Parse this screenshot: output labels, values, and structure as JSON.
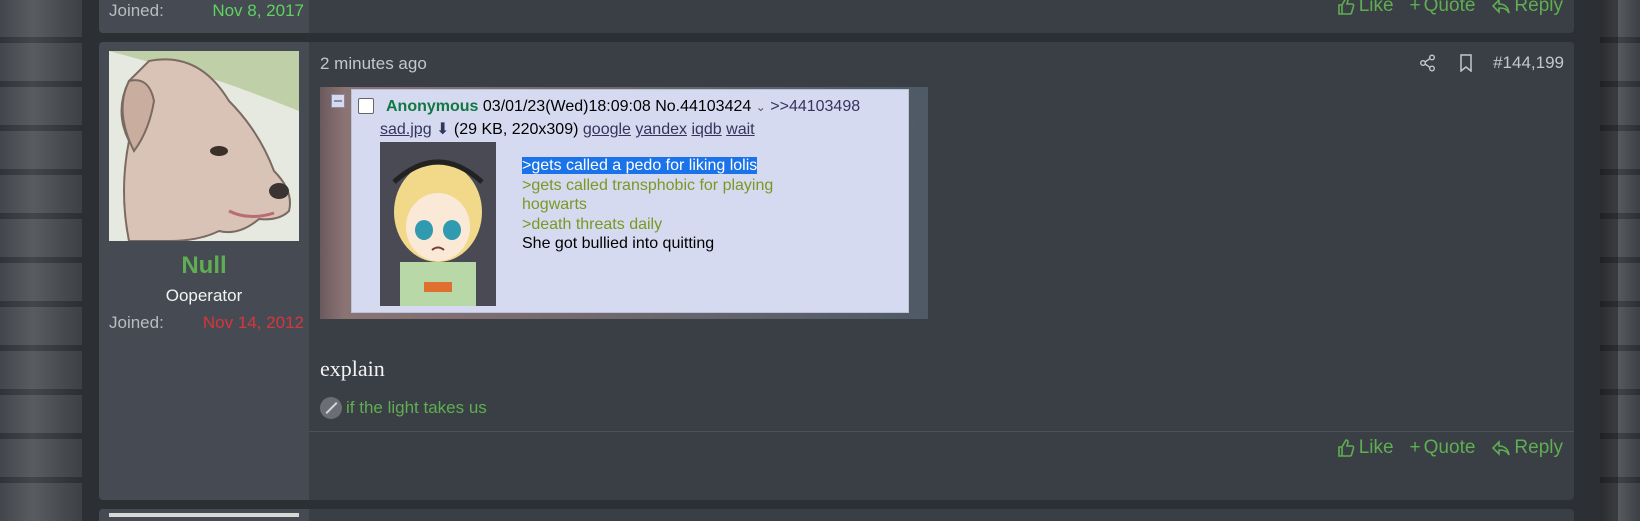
{
  "previous_post": {
    "joined_label": "Joined:",
    "joined_date": "Nov 8, 2017",
    "joined_color": "#5fd35f",
    "actions": {
      "like": "Like",
      "quote": "Quote",
      "reply": "Reply"
    }
  },
  "post": {
    "time": "2 minutes ago",
    "post_number": "#144,199",
    "user": {
      "name": "Null",
      "title": "Ooperator",
      "joined_label": "Joined:",
      "joined_date": "Nov 14, 2012",
      "joined_color": "#d9353c",
      "name_color": "#5fae52"
    },
    "embedded_screenshot": {
      "poster": "Anonymous",
      "date": "03/01/23(Wed)18:09:08",
      "number": "No.44103424",
      "reply_ref": ">>44103498",
      "file_name": "sad.jpg",
      "file_info": "(29 KB, 220x309)",
      "search_links": [
        "google",
        "yandex",
        "iqdb",
        "wait"
      ],
      "lines": [
        ">gets called a pedo for liking lolis",
        ">gets called transphobic for playing",
        "hogwarts",
        ">death threats daily",
        "She got bullied into quitting"
      ]
    },
    "text": "explain",
    "signature": "if the light takes us",
    "actions": {
      "like": "Like",
      "quote": "Quote",
      "reply": "Reply"
    }
  },
  "colors": {
    "accent_green": "#5fae52",
    "panel": "#3a3e45",
    "user_panel": "#464a52"
  }
}
